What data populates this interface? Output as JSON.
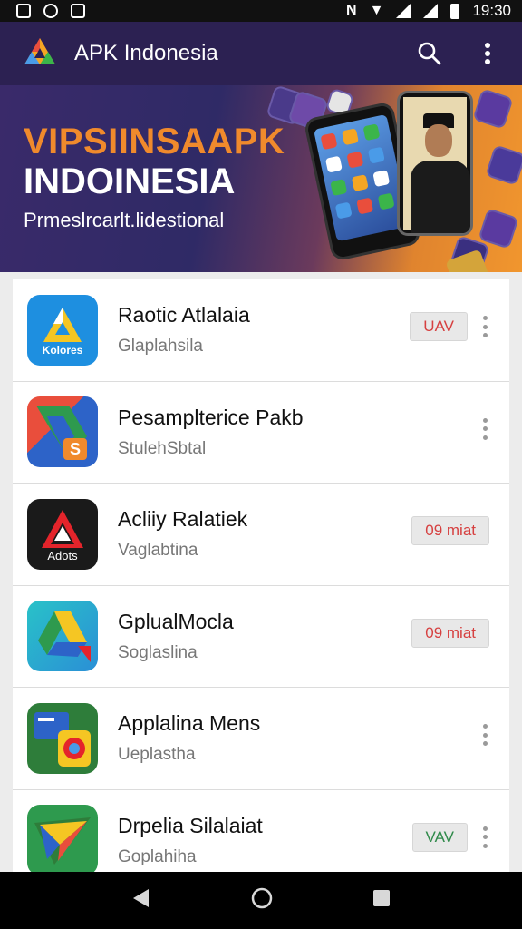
{
  "status_bar": {
    "time": "19:30"
  },
  "app_bar": {
    "title": "APK Indonesia",
    "search_icon": "search-icon",
    "menu_icon": "more-vert-icon"
  },
  "banner": {
    "headline_1": "VIPSIINSAAPK",
    "headline_2": "INDOINESIA",
    "subtitle": "Prmeslrcarlt.lidestional"
  },
  "apps": [
    {
      "title": "Raotic Atlalaia",
      "subtitle": "Glaplahsila",
      "badge": "UAV",
      "badge_color": "#d64040",
      "has_menu": true
    },
    {
      "title": "Pesamplterice Pakb",
      "subtitle": "StulehSbtal",
      "badge": "",
      "has_menu": true
    },
    {
      "title": "Acliiy Ralatiek",
      "subtitle": "Vaglabtina",
      "badge": "09 miat",
      "badge_color": "#d64040",
      "has_menu": false
    },
    {
      "title": "GplualMocla",
      "subtitle": "Soglaslina",
      "badge": "09 miat",
      "badge_color": "#d64040",
      "has_menu": false
    },
    {
      "title": "Applalina Mens",
      "subtitle": "Ueplastha",
      "badge": "",
      "has_menu": true
    },
    {
      "title": "Drpelia Silalaiat",
      "subtitle": "Goplahiha",
      "badge": "VAV",
      "badge_color": "#2f8a4a",
      "has_menu": true
    }
  ],
  "app_icons": {
    "0": {
      "label": "Kolores"
    },
    "2": {
      "label": "Adots"
    },
    "1": {
      "label": "S"
    }
  },
  "nav": {
    "back": "back-icon",
    "home": "home-icon",
    "recents": "recents-icon"
  }
}
